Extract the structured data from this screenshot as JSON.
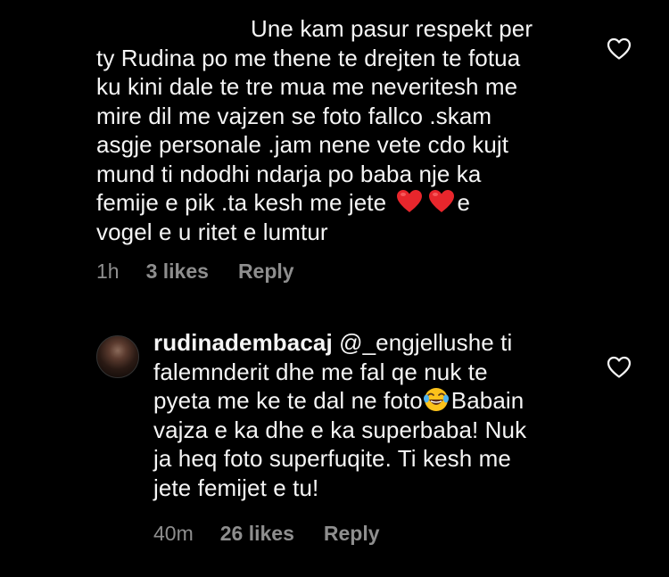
{
  "comments": [
    {
      "line_1": "Une kam pasur respekt per",
      "line_2": "ty Rudina po me thene te drejten te fotua",
      "line_3": "ku kini dale te tre mua me neveritesh me",
      "line_4": "mire dil me vajzen se foto fallco .skam",
      "line_5": "asgje personale .jam nene vete cdo kujt",
      "line_6": "mund ti ndodhi ndarja po baba nje ka",
      "line_7_before": "femije e pik .ta kesh me jete",
      "line_7_after": "e",
      "line_8": "vogel e u ritet e lumtur",
      "time": "1h",
      "likes": "3 likes",
      "reply_label": "Reply"
    },
    {
      "username": "rudinadembacaj",
      "line_1_rest": " @_engjellushe ti",
      "line_2": "falemnderit dhe me fal qe nuk te",
      "line_3_before": "pyeta me ke te dal ne foto",
      "line_3_after": "Babain",
      "line_4": "vajza e ka dhe e ka superbaba! Nuk",
      "line_5": "ja heq foto superfuqite. Ti kesh me",
      "line_6": "jete femijet e tu!",
      "time": "40m",
      "likes": "26 likes",
      "reply_label": "Reply"
    }
  ],
  "icons": {
    "like": "heart-outline-icon",
    "emoji_heart": "red-heart-emoji",
    "emoji_laugh": "tears-of-joy-emoji"
  },
  "colors": {
    "background": "#000000",
    "text": "#f5f5f5",
    "meta": "#8e8e8e",
    "emoji_heart": "#e8262c"
  }
}
